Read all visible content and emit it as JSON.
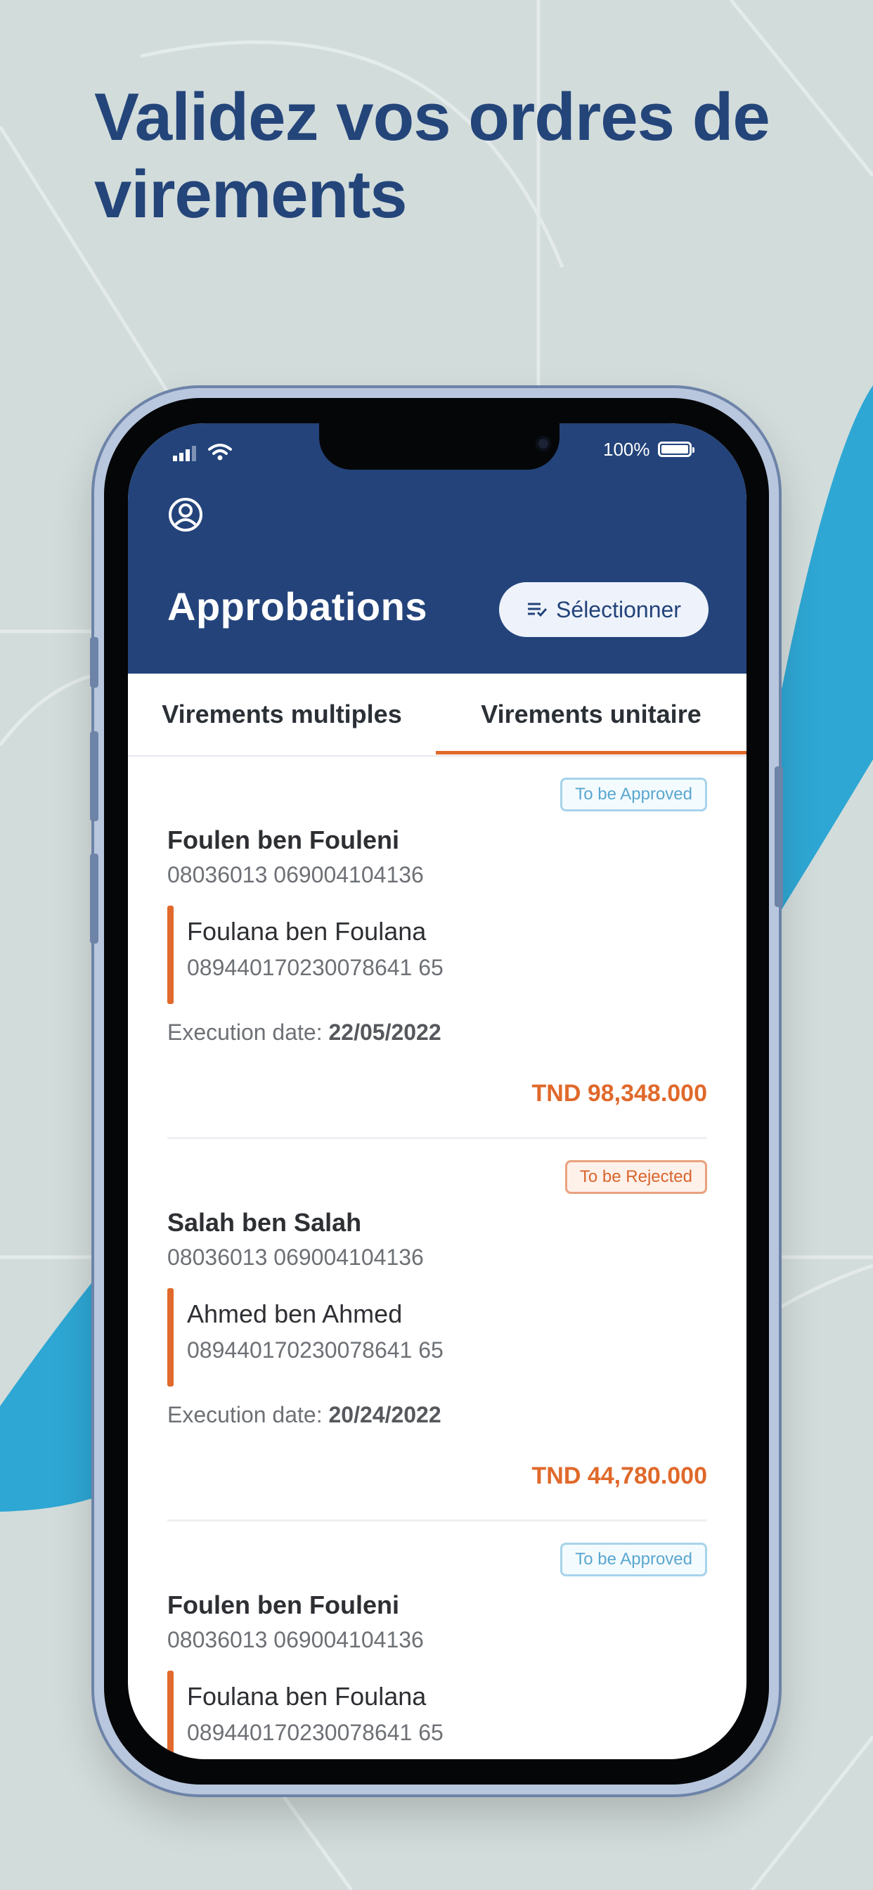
{
  "headline": "Validez vos ordres de virements",
  "status_bar": {
    "battery_pct": "100%"
  },
  "app": {
    "title": "Approbations",
    "select_label": "Sélectionner"
  },
  "tabs": [
    {
      "label": "Virements multiples",
      "active": false
    },
    {
      "label": "Virements unitaire",
      "active": true
    }
  ],
  "transfers": [
    {
      "status": "To be Approved",
      "sender_name": "Foulen ben Fouleni",
      "sender_account": "08036013 069004104136",
      "receiver_name": "Foulana ben Foulana",
      "receiver_account": "089440170230078641 65",
      "execution_label": "Execution date:",
      "execution_date": "22/05/2022",
      "amount": "TND 98,348.000"
    },
    {
      "status": "To be Rejected",
      "sender_name": "Salah ben Salah",
      "sender_account": "08036013 069004104136",
      "receiver_name": "Ahmed ben Ahmed",
      "receiver_account": "089440170230078641 65",
      "execution_label": "Execution date:",
      "execution_date": "20/24/2022",
      "amount": "TND 44,780.000"
    },
    {
      "status": "To be Approved",
      "sender_name": "Foulen ben Fouleni",
      "sender_account": "08036013 069004104136",
      "receiver_name": "Foulana ben Foulana",
      "receiver_account": "089440170230078641 65"
    }
  ],
  "colors": {
    "background": "#d2dcdb",
    "brand_blue": "#23437a",
    "accent_orange": "#e0692b",
    "decor_blue": "#2ea7d4",
    "approved_badge": "#5aa7cf",
    "rejected_badge": "#d8652d"
  },
  "icons": {
    "profile": "profile-icon",
    "select": "list-check-icon",
    "signal": "signal-icon",
    "wifi": "wifi-icon",
    "battery": "battery-icon"
  }
}
